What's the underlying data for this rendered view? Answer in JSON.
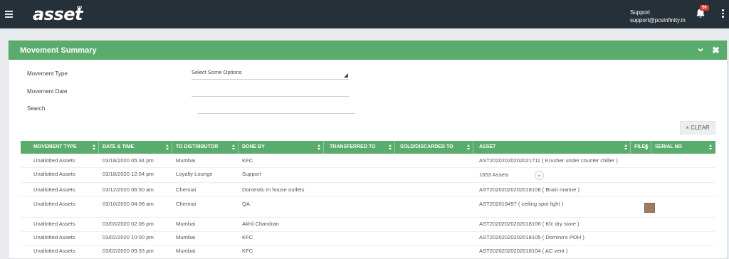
{
  "topbar": {
    "logo": "asset",
    "logo_suffix": "∞",
    "support_label": "Support",
    "support_email": "support@pcsinfinity.in",
    "notification_count": "56"
  },
  "panel": {
    "title": "Movement Summary"
  },
  "filters": {
    "movement_type_label": "Movement Type",
    "movement_type_placeholder": "Select Some Options",
    "movement_date_label": "Movement Date",
    "movement_date_value": "",
    "search_label": "Search",
    "search_value": ""
  },
  "clear_button": "× CLEAR",
  "table": {
    "columns": [
      "MOVEMENT TYPE",
      "DATE & TIME",
      "TO DISTRIBUTOR",
      "DONE BY",
      "TRANSFERRED TO",
      "SOLD/DISCARDED TO",
      "ASSET",
      "FILES",
      "SERIAL NO"
    ],
    "rows": [
      {
        "type": "Unallotted Assets",
        "datetime": "03/18/2020 05:34 pm",
        "distributor": "Mumbai",
        "done_by": "KFC",
        "transferred_to": "",
        "sold_to": "",
        "asset": "AST20202020202021711 ( Krusher under counter chiller )",
        "serial": ""
      },
      {
        "type": "Unallotted Assets",
        "datetime": "03/18/2020 12:04 pm",
        "distributor": "Loyalty Lounge",
        "done_by": "Support",
        "transferred_to": "",
        "sold_to": "",
        "asset": "1653 Assets",
        "serial": ""
      },
      {
        "type": "Unallotted Assets",
        "datetime": "03/12/2020 06:50 am",
        "distributor": "Chennai",
        "done_by": "Domestic In house outlets",
        "transferred_to": "",
        "sold_to": "",
        "asset": "AST20202020202018108 ( Brain marine )",
        "serial": ""
      },
      {
        "type": "Unallotted Assets",
        "datetime": "03/10/2020 04:08 am",
        "distributor": "Chennai",
        "done_by": "QA",
        "transferred_to": "",
        "sold_to": "",
        "asset": "AST202019497 ( ceiling spot light )",
        "serial": ""
      },
      {
        "type": "Unallotted Assets",
        "datetime": "03/03/2020 02:06 pm",
        "distributor": "Mumbai",
        "done_by": "Akhil Chandran",
        "transferred_to": "",
        "sold_to": "",
        "asset": "AST20202020202018106 ( Kfc dry store )",
        "serial": ""
      },
      {
        "type": "Unallotted Assets",
        "datetime": "03/02/2020 10:00 pm",
        "distributor": "Mumbai",
        "done_by": "KFC",
        "transferred_to": "",
        "sold_to": "",
        "asset": "AST20202020202018105 ( Domino's POH )",
        "serial": ""
      },
      {
        "type": "Unallotted Assets",
        "datetime": "03/02/2020 09:33 pm",
        "distributor": "Mumbai",
        "done_by": "KFC",
        "transferred_to": "",
        "sold_to": "",
        "asset": "AST20202020202018104 ( AC vent )",
        "serial": ""
      }
    ]
  },
  "icons": {
    "menu": "hamburger-menu-icon",
    "notifications": "bell-icon",
    "more": "kebab-menu-icon",
    "collapse": "chevron-down-icon",
    "close": "close-icon",
    "expand_assets": "chevron-down-icon",
    "file_thumbnail": "image-thumbnail-icon"
  },
  "colors": {
    "topbar": "#253038",
    "accent_green": "#5aac6d",
    "badge_red": "#d93b2b"
  }
}
